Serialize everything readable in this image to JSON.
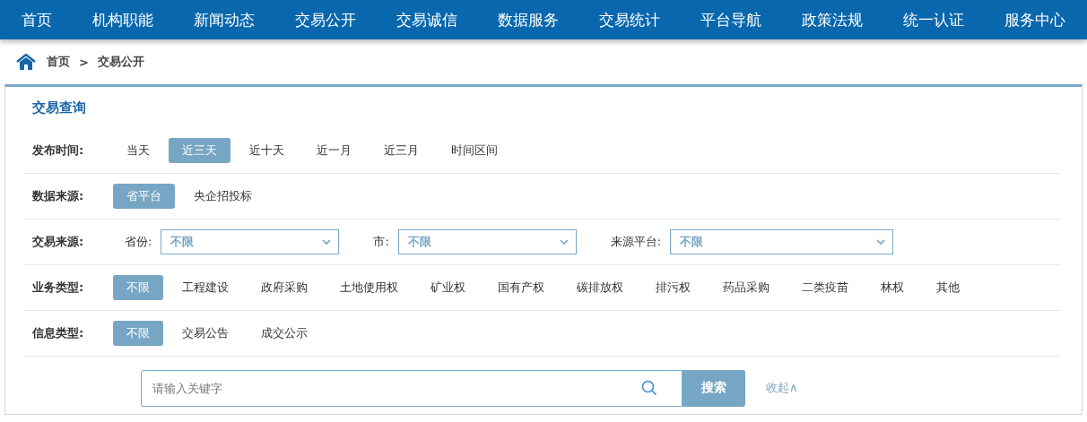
{
  "nav": [
    "首页",
    "机构职能",
    "新闻动态",
    "交易公开",
    "交易诚信",
    "数据服务",
    "交易统计",
    "平台导航",
    "政策法规",
    "统一认证",
    "服务中心"
  ],
  "breadcrumb": {
    "home": "首页",
    "separator": ">",
    "current": "交易公开"
  },
  "query": {
    "title": "交易查询",
    "filters": [
      {
        "kind": "options",
        "label": "发布时间:",
        "options": [
          {
            "label": "当天",
            "selected": false
          },
          {
            "label": "近三天",
            "selected": true
          },
          {
            "label": "近十天",
            "selected": false
          },
          {
            "label": "近一月",
            "selected": false
          },
          {
            "label": "近三月",
            "selected": false
          },
          {
            "label": "时间区间",
            "selected": false
          }
        ]
      },
      {
        "kind": "options",
        "label": "数据来源:",
        "options": [
          {
            "label": "省平台",
            "selected": true
          },
          {
            "label": "央企招投标",
            "selected": false
          }
        ]
      },
      {
        "kind": "selects",
        "label": "交易来源:",
        "selects": [
          {
            "label": "省份:",
            "value": "不限"
          },
          {
            "label": "市:",
            "value": "不限"
          },
          {
            "label": "来源平台:",
            "value": "不限"
          }
        ]
      },
      {
        "kind": "options",
        "label": "业务类型:",
        "options": [
          {
            "label": "不限",
            "selected": true
          },
          {
            "label": "工程建设",
            "selected": false
          },
          {
            "label": "政府采购",
            "selected": false
          },
          {
            "label": "土地使用权",
            "selected": false
          },
          {
            "label": "矿业权",
            "selected": false
          },
          {
            "label": "国有产权",
            "selected": false
          },
          {
            "label": "碳排放权",
            "selected": false
          },
          {
            "label": "排污权",
            "selected": false
          },
          {
            "label": "药品采购",
            "selected": false
          },
          {
            "label": "二类疫苗",
            "selected": false
          },
          {
            "label": "林权",
            "selected": false
          },
          {
            "label": "其他",
            "selected": false
          }
        ]
      },
      {
        "kind": "options",
        "label": "信息类型:",
        "options": [
          {
            "label": "不限",
            "selected": true
          },
          {
            "label": "交易公告",
            "selected": false
          },
          {
            "label": "成交公示",
            "selected": false
          }
        ]
      }
    ],
    "search": {
      "placeholder": "请输入关键字",
      "button": "搜索",
      "collapse": "收起∧"
    }
  }
}
